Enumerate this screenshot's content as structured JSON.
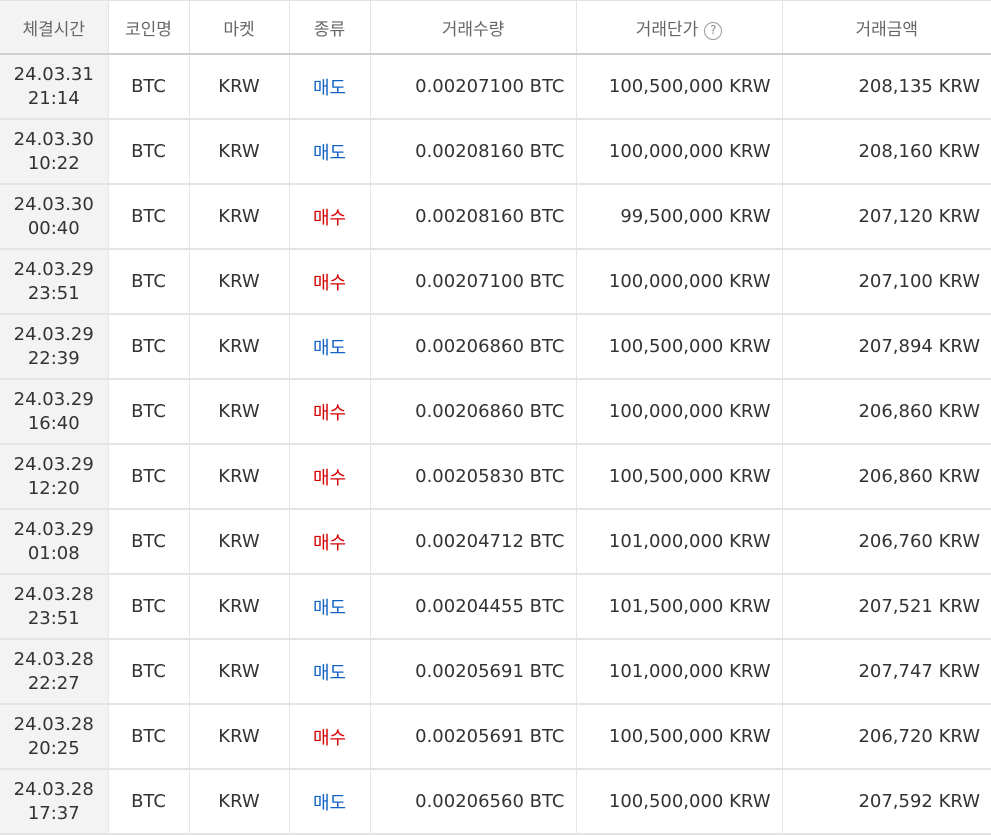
{
  "table": {
    "headers": {
      "time": "체결시간",
      "coin": "코인명",
      "market": "마켓",
      "type": "종류",
      "quantity": "거래수량",
      "price": "거래단가",
      "amount": "거래금액",
      "price_help_icon": "?"
    },
    "colors": {
      "sell": "#1261c4",
      "buy": "#d60000"
    },
    "rows": [
      {
        "date": "24.03.31",
        "time": "21:14",
        "coin": "BTC",
        "market": "KRW",
        "type": "매도",
        "side": "sell",
        "quantity": "0.00207100 BTC",
        "price": "100,500,000 KRW",
        "amount": "208,135 KRW"
      },
      {
        "date": "24.03.30",
        "time": "10:22",
        "coin": "BTC",
        "market": "KRW",
        "type": "매도",
        "side": "sell",
        "quantity": "0.00208160 BTC",
        "price": "100,000,000 KRW",
        "amount": "208,160 KRW"
      },
      {
        "date": "24.03.30",
        "time": "00:40",
        "coin": "BTC",
        "market": "KRW",
        "type": "매수",
        "side": "buy",
        "quantity": "0.00208160 BTC",
        "price": "99,500,000 KRW",
        "amount": "207,120 KRW"
      },
      {
        "date": "24.03.29",
        "time": "23:51",
        "coin": "BTC",
        "market": "KRW",
        "type": "매수",
        "side": "buy",
        "quantity": "0.00207100 BTC",
        "price": "100,000,000 KRW",
        "amount": "207,100 KRW"
      },
      {
        "date": "24.03.29",
        "time": "22:39",
        "coin": "BTC",
        "market": "KRW",
        "type": "매도",
        "side": "sell",
        "quantity": "0.00206860 BTC",
        "price": "100,500,000 KRW",
        "amount": "207,894 KRW"
      },
      {
        "date": "24.03.29",
        "time": "16:40",
        "coin": "BTC",
        "market": "KRW",
        "type": "매수",
        "side": "buy",
        "quantity": "0.00206860 BTC",
        "price": "100,000,000 KRW",
        "amount": "206,860 KRW"
      },
      {
        "date": "24.03.29",
        "time": "12:20",
        "coin": "BTC",
        "market": "KRW",
        "type": "매수",
        "side": "buy",
        "quantity": "0.00205830 BTC",
        "price": "100,500,000 KRW",
        "amount": "206,860 KRW"
      },
      {
        "date": "24.03.29",
        "time": "01:08",
        "coin": "BTC",
        "market": "KRW",
        "type": "매수",
        "side": "buy",
        "quantity": "0.00204712 BTC",
        "price": "101,000,000 KRW",
        "amount": "206,760 KRW"
      },
      {
        "date": "24.03.28",
        "time": "23:51",
        "coin": "BTC",
        "market": "KRW",
        "type": "매도",
        "side": "sell",
        "quantity": "0.00204455 BTC",
        "price": "101,500,000 KRW",
        "amount": "207,521 KRW"
      },
      {
        "date": "24.03.28",
        "time": "22:27",
        "coin": "BTC",
        "market": "KRW",
        "type": "매도",
        "side": "sell",
        "quantity": "0.00205691 BTC",
        "price": "101,000,000 KRW",
        "amount": "207,747 KRW"
      },
      {
        "date": "24.03.28",
        "time": "20:25",
        "coin": "BTC",
        "market": "KRW",
        "type": "매수",
        "side": "buy",
        "quantity": "0.00205691 BTC",
        "price": "100,500,000 KRW",
        "amount": "206,720 KRW"
      },
      {
        "date": "24.03.28",
        "time": "17:37",
        "coin": "BTC",
        "market": "KRW",
        "type": "매도",
        "side": "sell",
        "quantity": "0.00206560 BTC",
        "price": "100,500,000 KRW",
        "amount": "207,592 KRW"
      }
    ]
  }
}
